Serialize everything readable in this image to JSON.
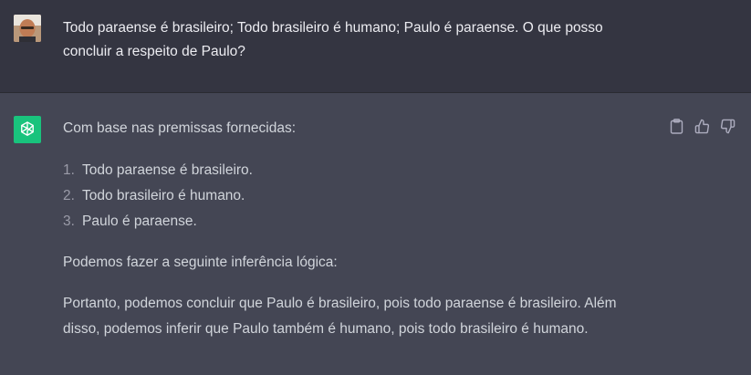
{
  "user_message": {
    "text": "Todo paraense é brasileiro;  Todo brasileiro é humano; Paulo é paraense. O que posso concluir a respeito de Paulo?"
  },
  "assistant_message": {
    "intro": "Com base nas premissas fornecidas:",
    "premises": [
      {
        "number": "1.",
        "text": "Todo paraense é brasileiro."
      },
      {
        "number": "2.",
        "text": "Todo brasileiro é humano."
      },
      {
        "number": "3.",
        "text": "Paulo é paraense."
      }
    ],
    "inference": "Podemos fazer a seguinte inferência lógica:",
    "conclusion": "Portanto, podemos concluir que Paulo é brasileiro, pois todo paraense é brasileiro. Além disso, podemos inferir que Paulo também é humano, pois todo brasileiro é humano."
  },
  "icons": {
    "copy": "clipboard-icon",
    "like": "thumbs-up-icon",
    "dislike": "thumbs-down-icon",
    "assistant_logo": "openai-logo-icon"
  },
  "colors": {
    "user_bg": "#343541",
    "assistant_bg": "#444654",
    "assistant_logo_bg": "#19c37d",
    "text": "#d1d5db"
  }
}
